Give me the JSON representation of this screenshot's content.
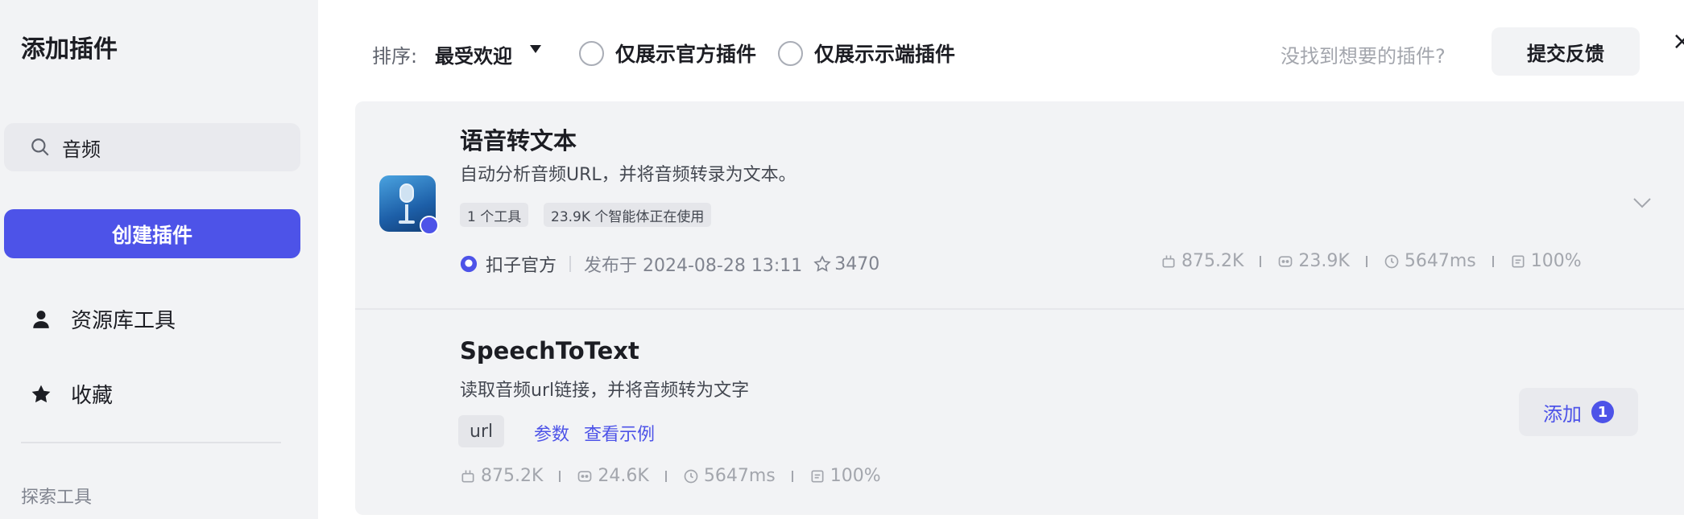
{
  "sidebar": {
    "title": "添加插件",
    "search": {
      "value": "音频"
    },
    "create_button": "创建插件",
    "items": [
      {
        "label": "资源库工具",
        "icon": "user-icon"
      },
      {
        "label": "收藏",
        "icon": "star-icon"
      }
    ],
    "section_label": "探索工具"
  },
  "toolbar": {
    "sort_label": "排序:",
    "sort_value": "最受欢迎",
    "filters": [
      {
        "label": "仅展示官方插件",
        "checked": false
      },
      {
        "label": "仅展示示端插件",
        "checked": false
      }
    ],
    "not_found_text": "没找到想要的插件?",
    "feedback_button": "提交反馈",
    "close_label": "×"
  },
  "plugins": [
    {
      "title": "语音转文本",
      "description": "自动分析音频URL，并将音频转录为文本。",
      "tags": [
        "1 个工具",
        "23.9K 个智能体正在使用"
      ],
      "publisher": "扣子官方",
      "published": "发布于 2024-08-28 13:11",
      "favorites": "3470",
      "stats": {
        "calls": "875.2K",
        "bots": "23.9K",
        "latency": "5647ms",
        "success": "100%"
      },
      "expanded": false
    },
    {
      "title": "SpeechToText",
      "description": "读取音频url链接，并将音频转为文字",
      "param_tag": "url",
      "links": {
        "params": "参数",
        "example": "查看示例"
      },
      "stats": {
        "calls": "875.2K",
        "bots": "24.6K",
        "latency": "5647ms",
        "success": "100%"
      },
      "add_button": {
        "label": "添加",
        "count": "1"
      }
    }
  ],
  "colors": {
    "accent": "#4d53e8",
    "panel": "#f2f3f5"
  }
}
